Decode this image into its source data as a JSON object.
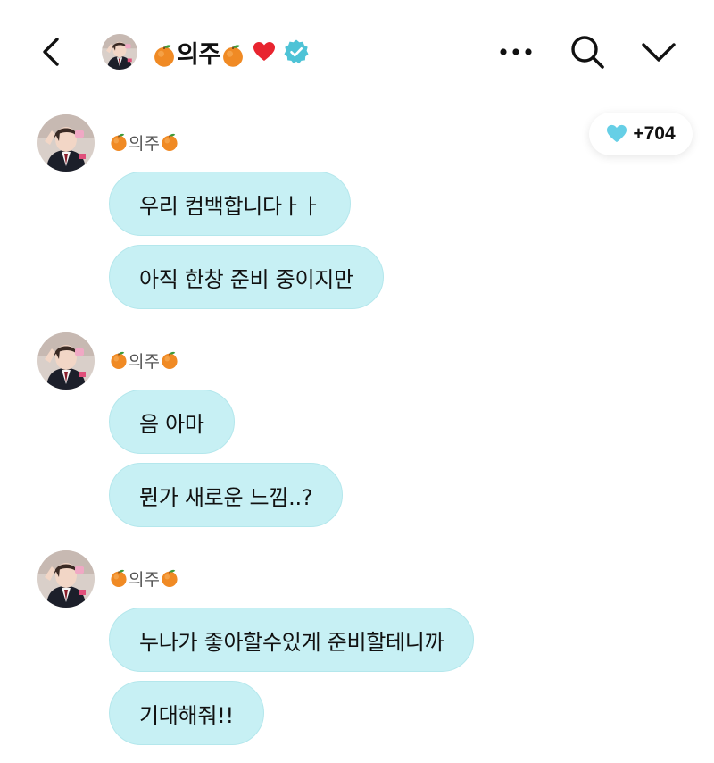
{
  "header": {
    "title": "의주",
    "icons": [
      "back-icon",
      "orange-emoji-icon",
      "heart-icon",
      "verified-badge-icon",
      "more-icon",
      "search-icon",
      "chevron-down-icon"
    ],
    "colors": {
      "verified": "#4ec3d6",
      "heart": "#e8242f"
    }
  },
  "reaction": {
    "icon": "light-blue-heart-icon",
    "count": "+704",
    "color": "#66cfe6"
  },
  "bubble_color": "#c7f0f4",
  "messages": [
    {
      "sender": "의주",
      "bubbles": [
        "우리 컴백합니다ㅏㅏ",
        "아직 한창 준비 중이지만"
      ]
    },
    {
      "sender": "의주",
      "bubbles": [
        "음 아마",
        "뭔가 새로운 느낌..?"
      ]
    },
    {
      "sender": "의주",
      "bubbles": [
        "누나가 좋아할수있게 준비할테니까",
        "기대해줘!!"
      ]
    }
  ]
}
